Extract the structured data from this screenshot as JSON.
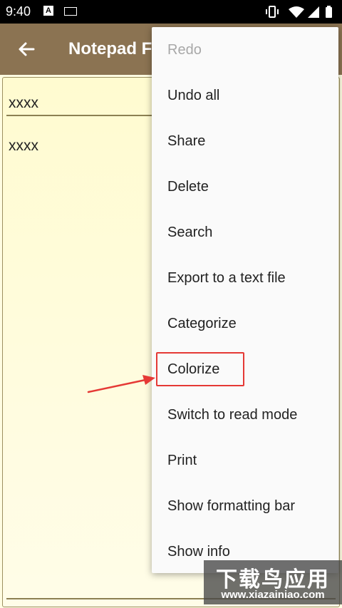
{
  "status_bar": {
    "time": "9:40"
  },
  "toolbar": {
    "title": "Notepad F"
  },
  "note": {
    "title": "xxxx",
    "body": "xxxx"
  },
  "menu": {
    "items": [
      {
        "label": "Redo",
        "enabled": false
      },
      {
        "label": "Undo all",
        "enabled": true
      },
      {
        "label": "Share",
        "enabled": true
      },
      {
        "label": "Delete",
        "enabled": true
      },
      {
        "label": "Search",
        "enabled": true
      },
      {
        "label": "Export to a text file",
        "enabled": true
      },
      {
        "label": "Categorize",
        "enabled": true
      },
      {
        "label": "Colorize",
        "enabled": true,
        "highlighted": true
      },
      {
        "label": "Switch to read mode",
        "enabled": true
      },
      {
        "label": "Print",
        "enabled": true
      },
      {
        "label": "Show formatting bar",
        "enabled": true
      },
      {
        "label": "Show info",
        "enabled": true
      }
    ]
  },
  "watermark": {
    "line1": "下载鸟应用",
    "line2": "www.xiazainiao.com"
  },
  "colors": {
    "toolbar": "#8b7352",
    "paper": "#fffbd0",
    "highlight": "#e53935"
  }
}
